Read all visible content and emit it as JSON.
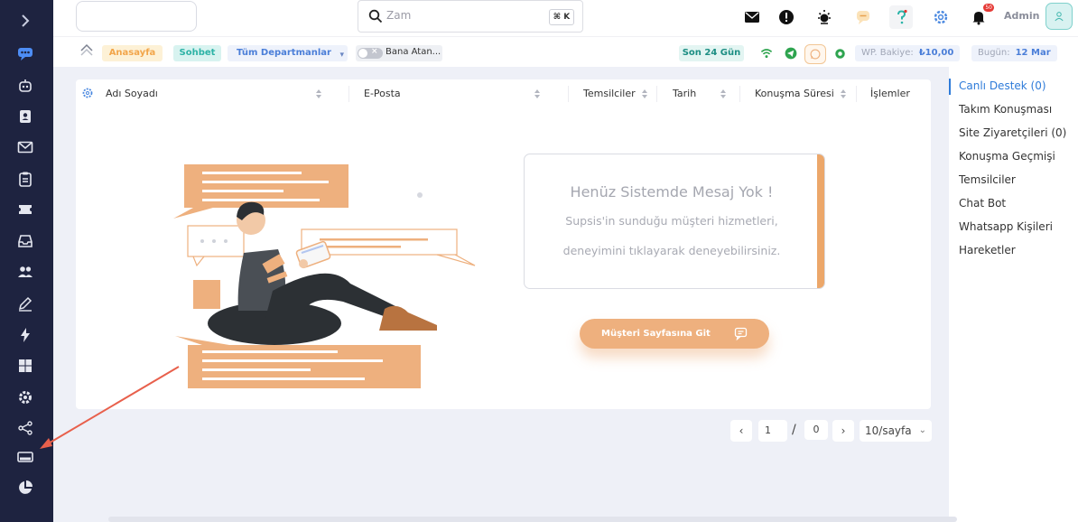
{
  "search": {
    "placeholder": "Zam",
    "shortcut": "⌘ K"
  },
  "user": {
    "name": "Admin"
  },
  "notifications": {
    "count": "50"
  },
  "subbar": {
    "home": "Anasayfa",
    "chat": "Sohbet",
    "department": "Tüm Departmanlar",
    "assigned_toggle": "Bana Atan...",
    "range": "Son 24 Gün",
    "wp_balance_label": "WP. Bakiye:",
    "wp_balance_value": "₺10,00",
    "today_label": "Bugün:",
    "today_value": "12 Mar"
  },
  "table": {
    "columns": [
      "Adı Soyadı",
      "E-Posta",
      "Temsilciler",
      "Tarih",
      "Konuşma Süresi",
      "İşlemler"
    ]
  },
  "empty_state": {
    "title": "Henüz Sistemde Mesaj Yok !",
    "line1": "Supsis'in sunduğu müşteri hizmetleri,",
    "line2": "deneyimini tıklayarak deneyebilirsiniz.",
    "cta": "Müşteri Sayfasına Git"
  },
  "pagination": {
    "current": "1",
    "separator": "/",
    "total": "0",
    "page_size": "10/sayfa",
    "prev": "‹",
    "next": "›"
  },
  "right_panel": {
    "items": [
      "Canlı Destek (0)",
      "Takım Konuşması",
      "Site Ziyaretçileri (0)",
      "Konuşma Geçmişi",
      "Temsilciler",
      "Chat Bot",
      "Whatsapp Kişileri",
      "Hareketler"
    ]
  },
  "colors": {
    "sidebar": "#1e2340",
    "accent_orange": "#eeb07e",
    "accent_blue": "#2e7bd9",
    "annotation_arrow": "#e8604c"
  }
}
